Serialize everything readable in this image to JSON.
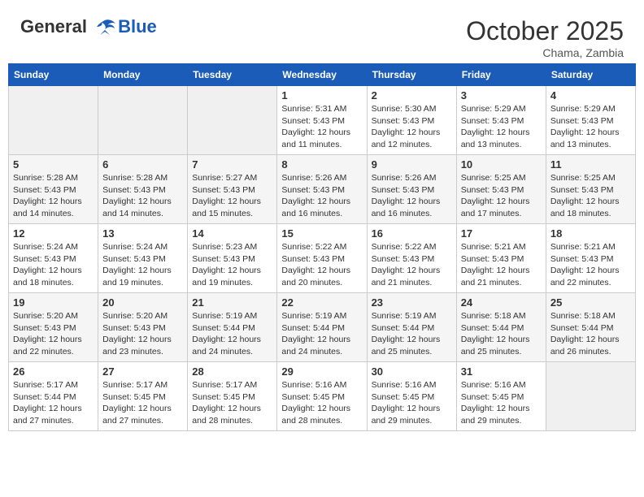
{
  "header": {
    "logo_line1": "General",
    "logo_line2": "Blue",
    "month": "October 2025",
    "location": "Chama, Zambia"
  },
  "days_of_week": [
    "Sunday",
    "Monday",
    "Tuesday",
    "Wednesday",
    "Thursday",
    "Friday",
    "Saturday"
  ],
  "weeks": [
    [
      {
        "day": "",
        "info": ""
      },
      {
        "day": "",
        "info": ""
      },
      {
        "day": "",
        "info": ""
      },
      {
        "day": "1",
        "info": "Sunrise: 5:31 AM\nSunset: 5:43 PM\nDaylight: 12 hours\nand 11 minutes."
      },
      {
        "day": "2",
        "info": "Sunrise: 5:30 AM\nSunset: 5:43 PM\nDaylight: 12 hours\nand 12 minutes."
      },
      {
        "day": "3",
        "info": "Sunrise: 5:29 AM\nSunset: 5:43 PM\nDaylight: 12 hours\nand 13 minutes."
      },
      {
        "day": "4",
        "info": "Sunrise: 5:29 AM\nSunset: 5:43 PM\nDaylight: 12 hours\nand 13 minutes."
      }
    ],
    [
      {
        "day": "5",
        "info": "Sunrise: 5:28 AM\nSunset: 5:43 PM\nDaylight: 12 hours\nand 14 minutes."
      },
      {
        "day": "6",
        "info": "Sunrise: 5:28 AM\nSunset: 5:43 PM\nDaylight: 12 hours\nand 14 minutes."
      },
      {
        "day": "7",
        "info": "Sunrise: 5:27 AM\nSunset: 5:43 PM\nDaylight: 12 hours\nand 15 minutes."
      },
      {
        "day": "8",
        "info": "Sunrise: 5:26 AM\nSunset: 5:43 PM\nDaylight: 12 hours\nand 16 minutes."
      },
      {
        "day": "9",
        "info": "Sunrise: 5:26 AM\nSunset: 5:43 PM\nDaylight: 12 hours\nand 16 minutes."
      },
      {
        "day": "10",
        "info": "Sunrise: 5:25 AM\nSunset: 5:43 PM\nDaylight: 12 hours\nand 17 minutes."
      },
      {
        "day": "11",
        "info": "Sunrise: 5:25 AM\nSunset: 5:43 PM\nDaylight: 12 hours\nand 18 minutes."
      }
    ],
    [
      {
        "day": "12",
        "info": "Sunrise: 5:24 AM\nSunset: 5:43 PM\nDaylight: 12 hours\nand 18 minutes."
      },
      {
        "day": "13",
        "info": "Sunrise: 5:24 AM\nSunset: 5:43 PM\nDaylight: 12 hours\nand 19 minutes."
      },
      {
        "day": "14",
        "info": "Sunrise: 5:23 AM\nSunset: 5:43 PM\nDaylight: 12 hours\nand 19 minutes."
      },
      {
        "day": "15",
        "info": "Sunrise: 5:22 AM\nSunset: 5:43 PM\nDaylight: 12 hours\nand 20 minutes."
      },
      {
        "day": "16",
        "info": "Sunrise: 5:22 AM\nSunset: 5:43 PM\nDaylight: 12 hours\nand 21 minutes."
      },
      {
        "day": "17",
        "info": "Sunrise: 5:21 AM\nSunset: 5:43 PM\nDaylight: 12 hours\nand 21 minutes."
      },
      {
        "day": "18",
        "info": "Sunrise: 5:21 AM\nSunset: 5:43 PM\nDaylight: 12 hours\nand 22 minutes."
      }
    ],
    [
      {
        "day": "19",
        "info": "Sunrise: 5:20 AM\nSunset: 5:43 PM\nDaylight: 12 hours\nand 22 minutes."
      },
      {
        "day": "20",
        "info": "Sunrise: 5:20 AM\nSunset: 5:43 PM\nDaylight: 12 hours\nand 23 minutes."
      },
      {
        "day": "21",
        "info": "Sunrise: 5:19 AM\nSunset: 5:44 PM\nDaylight: 12 hours\nand 24 minutes."
      },
      {
        "day": "22",
        "info": "Sunrise: 5:19 AM\nSunset: 5:44 PM\nDaylight: 12 hours\nand 24 minutes."
      },
      {
        "day": "23",
        "info": "Sunrise: 5:19 AM\nSunset: 5:44 PM\nDaylight: 12 hours\nand 25 minutes."
      },
      {
        "day": "24",
        "info": "Sunrise: 5:18 AM\nSunset: 5:44 PM\nDaylight: 12 hours\nand 25 minutes."
      },
      {
        "day": "25",
        "info": "Sunrise: 5:18 AM\nSunset: 5:44 PM\nDaylight: 12 hours\nand 26 minutes."
      }
    ],
    [
      {
        "day": "26",
        "info": "Sunrise: 5:17 AM\nSunset: 5:44 PM\nDaylight: 12 hours\nand 27 minutes."
      },
      {
        "day": "27",
        "info": "Sunrise: 5:17 AM\nSunset: 5:45 PM\nDaylight: 12 hours\nand 27 minutes."
      },
      {
        "day": "28",
        "info": "Sunrise: 5:17 AM\nSunset: 5:45 PM\nDaylight: 12 hours\nand 28 minutes."
      },
      {
        "day": "29",
        "info": "Sunrise: 5:16 AM\nSunset: 5:45 PM\nDaylight: 12 hours\nand 28 minutes."
      },
      {
        "day": "30",
        "info": "Sunrise: 5:16 AM\nSunset: 5:45 PM\nDaylight: 12 hours\nand 29 minutes."
      },
      {
        "day": "31",
        "info": "Sunrise: 5:16 AM\nSunset: 5:45 PM\nDaylight: 12 hours\nand 29 minutes."
      },
      {
        "day": "",
        "info": ""
      }
    ]
  ]
}
